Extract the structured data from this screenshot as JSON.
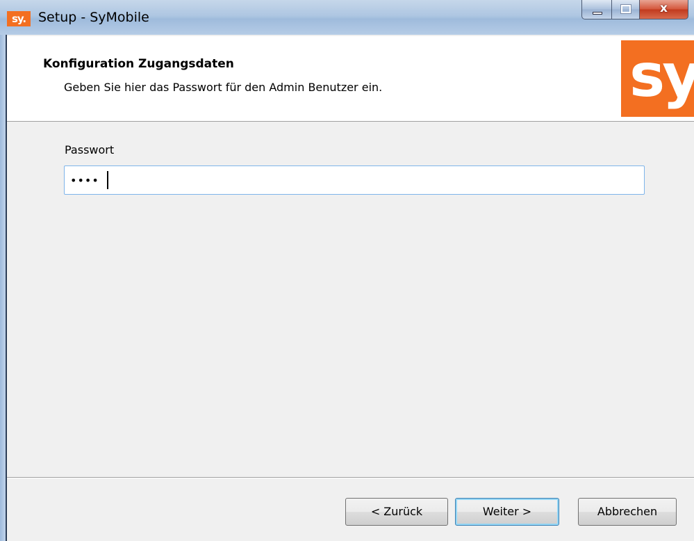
{
  "window": {
    "icon_text": "sy.",
    "title": "Setup - SyMobile",
    "close_glyph": "x"
  },
  "header": {
    "title": "Konfiguration Zugangsdaten",
    "subtitle": "Geben Sie hier das Passwort für den Admin Benutzer ein.",
    "logo_text": "sy."
  },
  "form": {
    "password_label": "Passwort",
    "password_value": "••••"
  },
  "footer": {
    "back_label": "< Zurück",
    "next_label": "Weiter >",
    "cancel_label": "Abbrechen"
  },
  "colors": {
    "brand_orange": "#f36f21",
    "focus_border": "#7eb4ea"
  }
}
